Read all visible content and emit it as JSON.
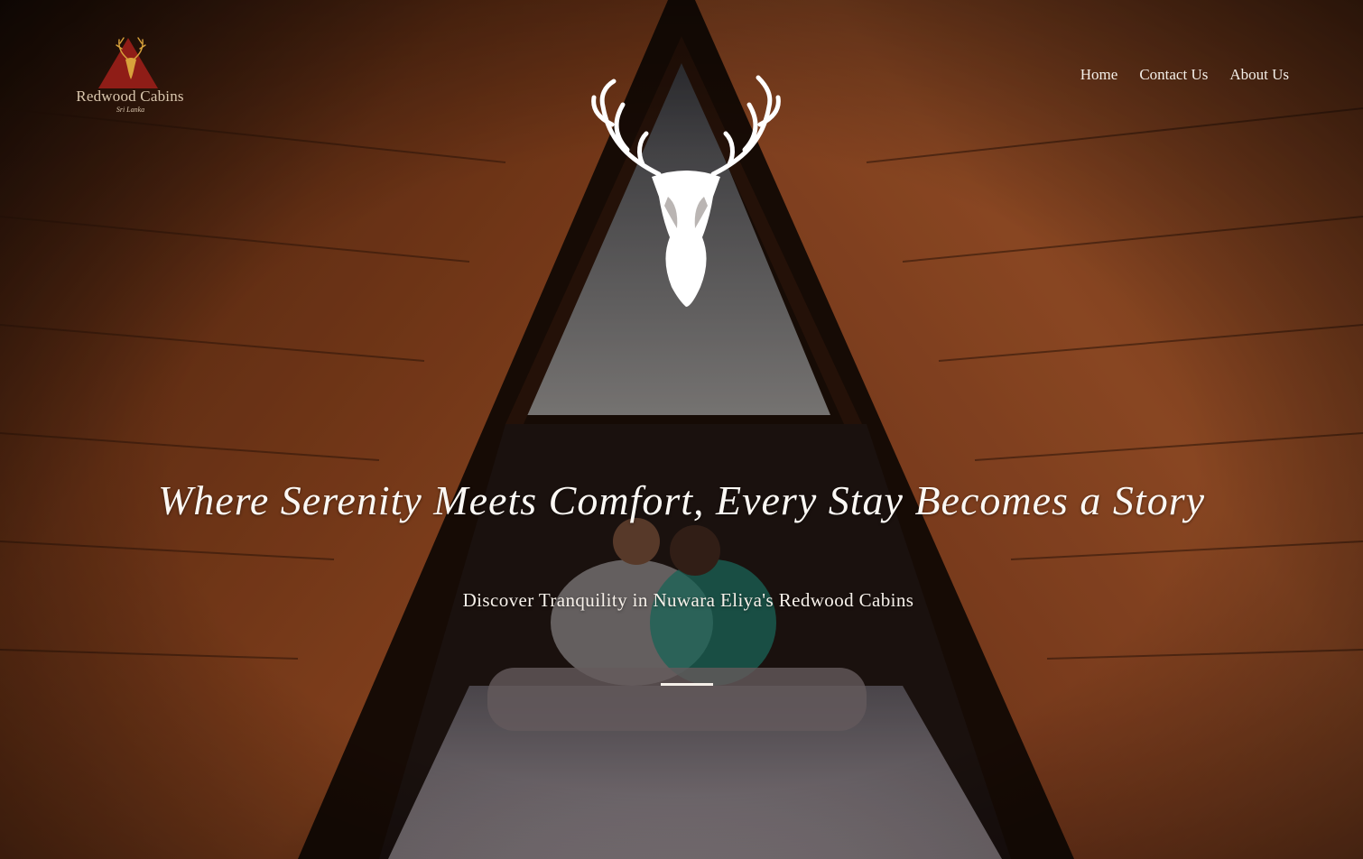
{
  "brand": {
    "name": "Redwood Cabins",
    "signature": "Sri Lanka",
    "accent": "#8f1d17"
  },
  "nav": {
    "items": [
      {
        "label": "Home"
      },
      {
        "label": "Contact Us"
      },
      {
        "label": "About Us"
      }
    ]
  },
  "hero": {
    "emblem_icon": "deer-head-icon",
    "tagline": "Where Serenity Meets Comfort, Every Stay Becomes a Story",
    "subtitle": "Discover Tranquility in Nuwara Eliya's Redwood Cabins"
  },
  "colors": {
    "wood": "#8a4421",
    "text": "#ffffff"
  }
}
